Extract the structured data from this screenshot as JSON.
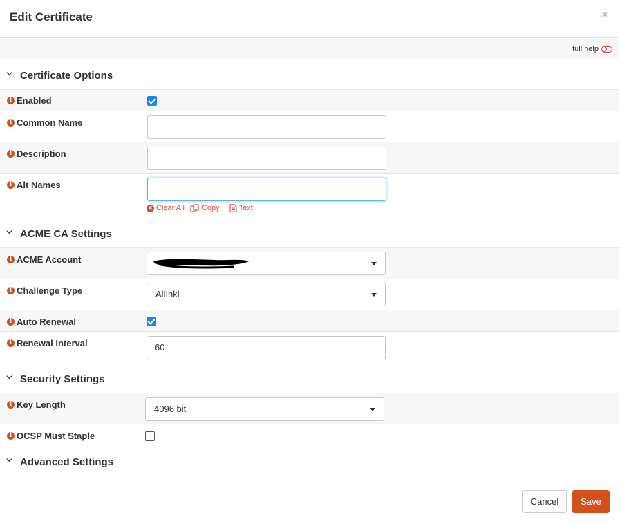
{
  "dialog": {
    "title": "Edit Certificate",
    "close_symbol": "×",
    "full_help_label": "full help"
  },
  "sections": {
    "certificate_options": "Certificate Options",
    "acme_ca_settings": "ACME CA Settings",
    "security_settings": "Security Settings",
    "advanced_settings": "Advanced Settings"
  },
  "fields": {
    "enabled": {
      "label": "Enabled",
      "checked": true
    },
    "common_name": {
      "label": "Common Name",
      "value": ""
    },
    "description": {
      "label": "Description",
      "value": ""
    },
    "alt_names": {
      "label": "Alt Names",
      "value": "",
      "actions": {
        "clear_all": "Clear All",
        "copy": "Copy",
        "text": "Text"
      }
    },
    "acme_account": {
      "label": "ACME Account",
      "value": ""
    },
    "challenge_type": {
      "label": "Challenge Type",
      "value": "AllInkl"
    },
    "auto_renewal": {
      "label": "Auto Renewal",
      "checked": true
    },
    "renewal_interval": {
      "label": "Renewal Interval",
      "value": "60"
    },
    "key_length": {
      "label": "Key Length",
      "value": "4096 bit"
    },
    "ocsp_must_staple": {
      "label": "OCSP Must Staple",
      "checked": false
    }
  },
  "footer": {
    "cancel_label": "Cancel",
    "save_label": "Save"
  },
  "colors": {
    "accent": "#d2501c",
    "checkbox_blue": "#1e88e5",
    "help_red": "#e0473b",
    "focus_border": "#66afe9"
  },
  "icons": {
    "info": "info-icon",
    "close": "close-icon",
    "toggle": "toggle-icon",
    "chevron": "chevron-down-icon",
    "clear": "x-circle-icon",
    "copy": "copy-icon",
    "text": "document-icon",
    "caret": "caret-down-icon"
  }
}
